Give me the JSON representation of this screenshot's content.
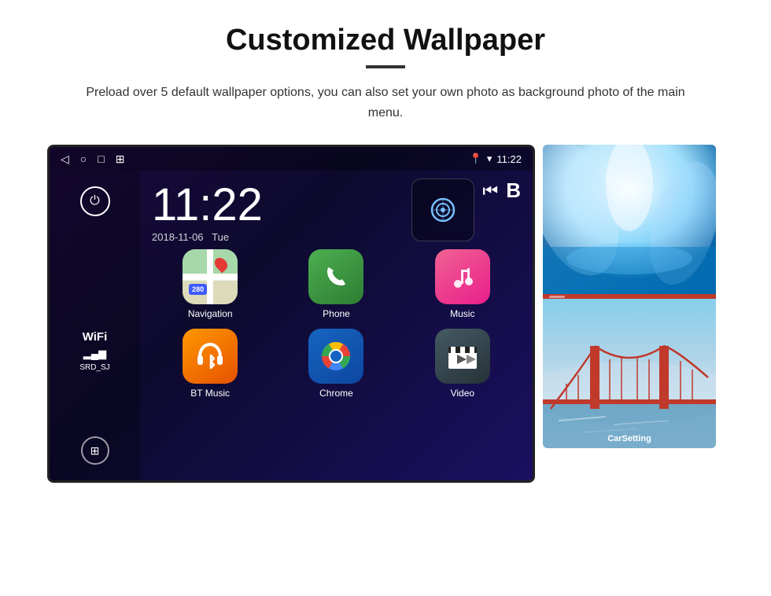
{
  "page": {
    "title": "Customized Wallpaper",
    "divider": true,
    "description": "Preload over 5 default wallpaper options, you can also set your own photo as background photo of the main menu."
  },
  "device": {
    "statusBar": {
      "time": "11:22",
      "navIcons": [
        "◁",
        "○",
        "□",
        "⊞"
      ],
      "rightIcons": [
        "📍",
        "▾"
      ]
    },
    "clock": {
      "time": "11:22",
      "date": "2018-11-06",
      "day": "Tue"
    },
    "wifi": {
      "label": "WiFi",
      "signal": "▂▄▆",
      "ssid": "SRD_SJ"
    },
    "apps": [
      {
        "id": "navigation",
        "label": "Navigation",
        "type": "navigation"
      },
      {
        "id": "phone",
        "label": "Phone",
        "type": "phone"
      },
      {
        "id": "music",
        "label": "Music",
        "type": "music"
      },
      {
        "id": "btmusic",
        "label": "BT Music",
        "type": "btmusic"
      },
      {
        "id": "chrome",
        "label": "Chrome",
        "type": "chrome"
      },
      {
        "id": "video",
        "label": "Video",
        "type": "video"
      }
    ],
    "wallpapers": [
      {
        "id": "ice-cave",
        "type": "ice"
      },
      {
        "id": "golden-gate",
        "type": "bridge",
        "label": "CarSetting"
      }
    ]
  }
}
